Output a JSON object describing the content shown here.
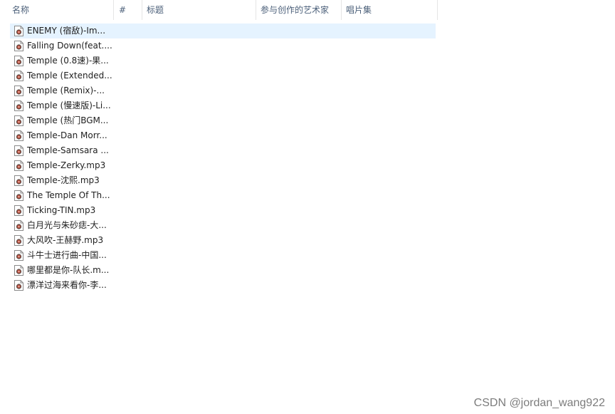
{
  "columns": [
    {
      "label": "名称"
    },
    {
      "label": "#"
    },
    {
      "label": "标题"
    },
    {
      "label": "参与创作的艺术家"
    },
    {
      "label": "唱片集"
    }
  ],
  "sort_indicator": "^",
  "files": [
    {
      "name": "ENEMY (宿敌)-Im..."
    },
    {
      "name": "Falling Down(feat...."
    },
    {
      "name": "Temple (0.8速)-果..."
    },
    {
      "name": "Temple (Extended..."
    },
    {
      "name": "Temple (Remix)-..."
    },
    {
      "name": "Temple (慢速版)-Li..."
    },
    {
      "name": "Temple (热门BGM..."
    },
    {
      "name": "Temple-Dan Morr..."
    },
    {
      "name": "Temple-Samsara ..."
    },
    {
      "name": "Temple-Zerky.mp3"
    },
    {
      "name": "Temple-沈熙.mp3"
    },
    {
      "name": "The Temple Of Th..."
    },
    {
      "name": "Ticking-TIN.mp3"
    },
    {
      "name": "白月光与朱砂痣-大..."
    },
    {
      "name": "大风吹-王赫野.mp3"
    },
    {
      "name": "斗牛士进行曲-中国..."
    },
    {
      "name": "哪里都是你-队长.m..."
    },
    {
      "name": "漂洋过海来看你-李..."
    }
  ],
  "selected_index": 0,
  "watermark": "CSDN @jordan_wang922",
  "colors": {
    "selection": "#e5f3ff",
    "header_text": "#4c607a"
  }
}
